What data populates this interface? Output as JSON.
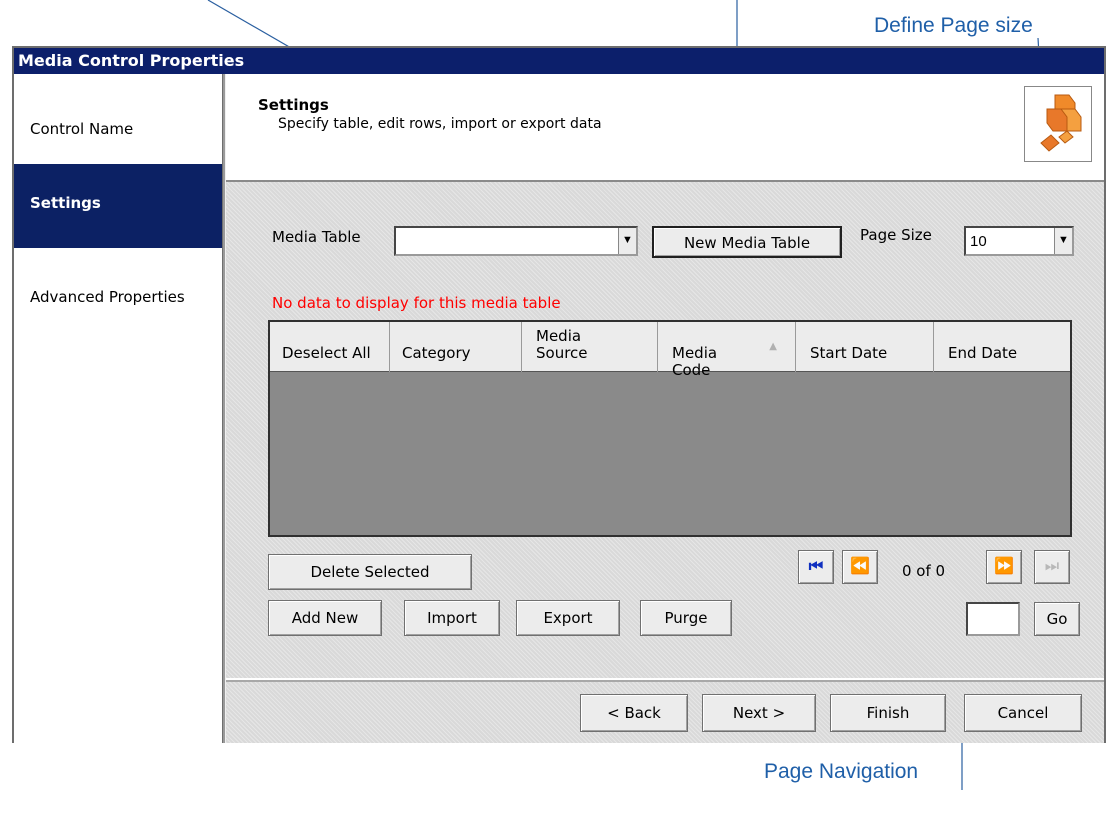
{
  "callouts": {
    "define_page_size": "Define Page size",
    "page_navigation": "Page Navigation"
  },
  "window": {
    "title": "Media Control Properties"
  },
  "sidebar": {
    "items": [
      {
        "label": "Control Name",
        "active": false
      },
      {
        "label": "Settings",
        "active": true
      },
      {
        "label": "Advanced Properties",
        "active": false
      }
    ]
  },
  "header": {
    "title": "Settings",
    "subtitle": "Specify table, edit rows, import or export data",
    "logo_icon": "orange-cubes-icon"
  },
  "media_table": {
    "label": "Media Table",
    "value": ""
  },
  "new_media_table_button": "New Media Table",
  "page_size": {
    "label": "Page Size",
    "value": "10"
  },
  "no_data_message": "No data to display for this media table",
  "table": {
    "columns": [
      "Deselect All",
      "Category",
      "Media\nSource",
      "Media\nCode",
      "Start Date",
      "End Date"
    ],
    "sort_column": "Media Code",
    "sort_indicator": "▲",
    "rows": []
  },
  "pagination": {
    "status": "0 of 0",
    "go_label": "Go",
    "page_input": "",
    "icons": [
      "first-page-icon",
      "previous-page-icon",
      "next-page-icon",
      "last-page-icon"
    ]
  },
  "actions": {
    "delete_selected": "Delete Selected",
    "add_new": "Add New",
    "import": "Import",
    "export": "Export",
    "purge": "Purge"
  },
  "footer": {
    "back": "< Back",
    "next": "Next >",
    "finish": "Finish",
    "cancel": "Cancel"
  },
  "colors": {
    "title_bar": "#0c1f6b",
    "active_item": "#0c2164",
    "callout_text": "#1f5fa8",
    "error_text": "#ff0000",
    "nav_icon": "#1030c0"
  }
}
